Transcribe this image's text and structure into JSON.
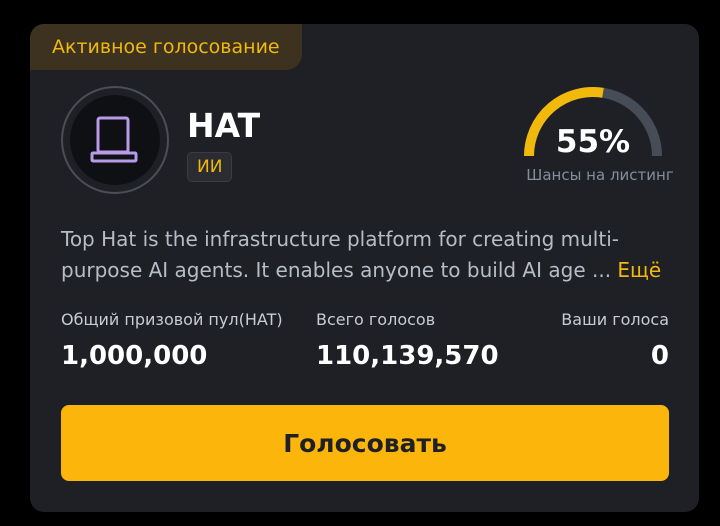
{
  "status_tag": "Активное голосование",
  "token": {
    "name": "HAT",
    "category": "ИИ",
    "icon": "laptop-icon"
  },
  "listing_chance": {
    "value_text": "55%",
    "value": 55,
    "label": "Шансы на листинг"
  },
  "description": {
    "line1": "Top Hat is the infrastructure platform for creating multi-",
    "line2": "purpose AI agents. It enables anyone to build AI age ...",
    "more_label": "Ещё"
  },
  "stats": {
    "prize_pool": {
      "label": "Общий призовой пул(HAT)",
      "value": "1,000,000"
    },
    "total_votes": {
      "label": "Всего голосов",
      "value": "110,139,570"
    },
    "your_votes": {
      "label": "Ваши голоса",
      "value": "0"
    }
  },
  "vote_button_label": "Голосовать",
  "colors": {
    "background": "#000000",
    "card": "#1e2026",
    "accent": "#f0b90b",
    "button": "#fcb50b",
    "gauge_track": "#474d57"
  }
}
